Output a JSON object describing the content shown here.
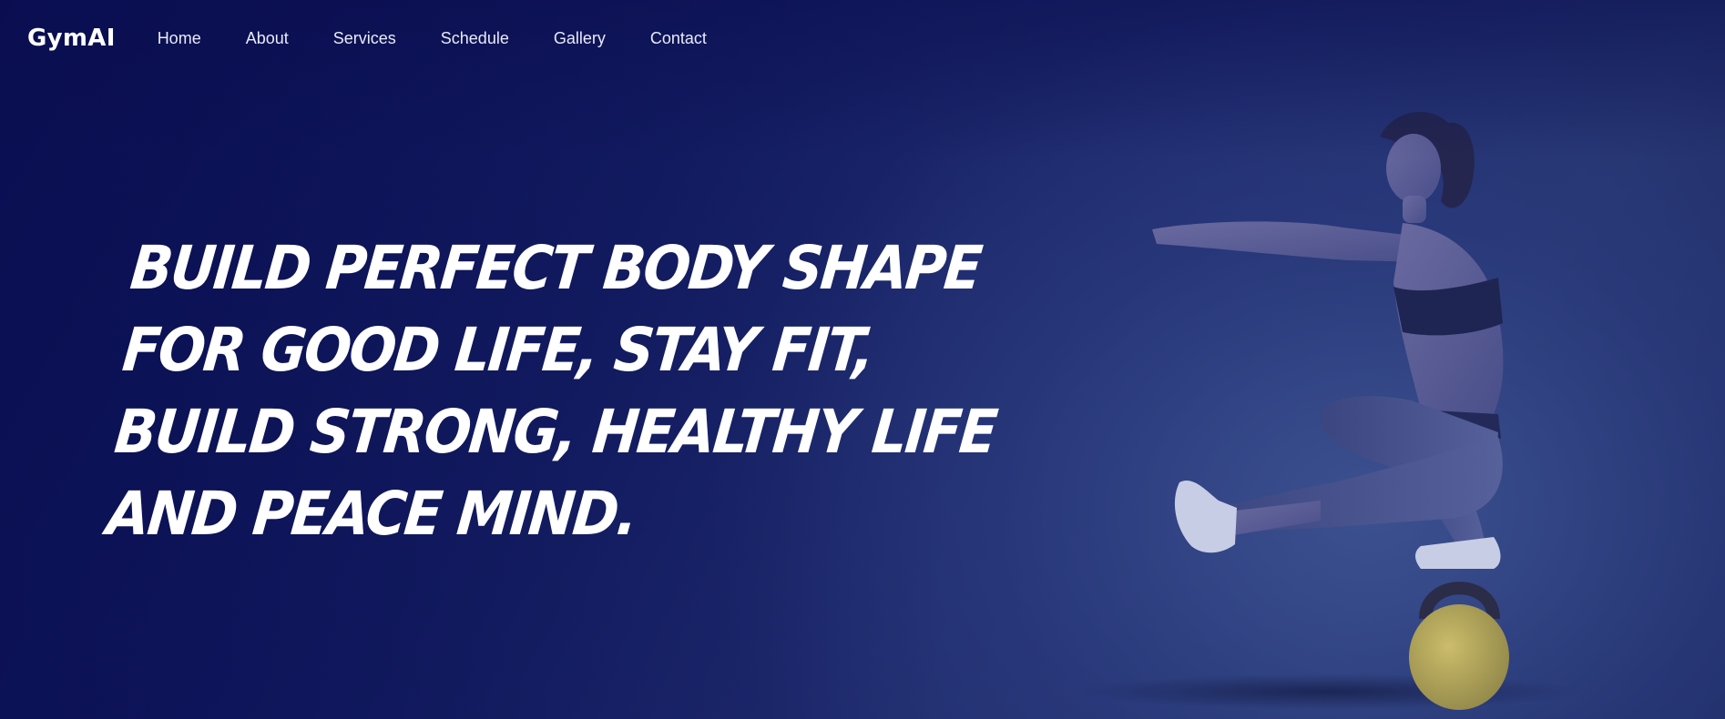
{
  "nav": {
    "brand": "GymAI",
    "links": [
      "Home",
      "About",
      "Services",
      "Schedule",
      "Gallery",
      "Contact"
    ]
  },
  "hero": {
    "headline_lines": [
      "BUILD PERFECT BODY SHAPE",
      "FOR GOOD LIFE, STAY FIT,",
      "BUILD STRONG, HEALTHY LIFE",
      "AND PEACE MIND."
    ],
    "image": "woman-pistol-squat-on-kettlebell"
  },
  "colors": {
    "overlay": "#0d1452",
    "text": "#ffffff",
    "kettlebell": "#b9ab5a"
  }
}
